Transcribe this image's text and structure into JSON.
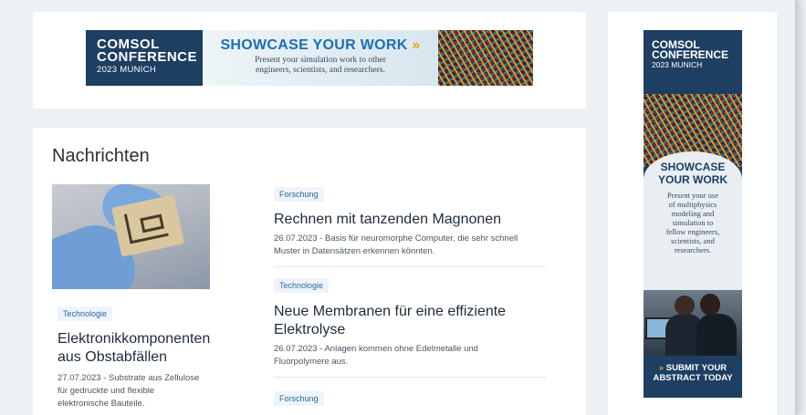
{
  "top_banner": {
    "logo_line1": "COMSOL",
    "logo_line2": "CONFERENCE",
    "logo_line3": "2023 MUNICH",
    "headline": "SHOWCASE YOUR WORK",
    "headline_arrow": "»",
    "sub_line1": "Present your simulation work to other",
    "sub_line2": "engineers, scientists, and researchers."
  },
  "news": {
    "section_title": "Nachrichten",
    "featured": {
      "tag": "Technologie",
      "title_line1": "Elektronikkomponenten",
      "title_line2": "aus Obstabfällen",
      "desc_line1": "27.07.2023 - Substrate aus Zellulose",
      "desc_line2": "für gedruckte und flexible",
      "desc_line3": "elektronische Bauteile."
    },
    "articles": [
      {
        "tag": "Forschung",
        "title_line1": "Rechnen mit tanzenden Magnonen",
        "desc_line1": "26.07.2023 - Basis für neuromorphe Computer, die sehr schnell",
        "desc_line2": "Muster in Datensätzen erkennen könnten."
      },
      {
        "tag": "Technologie",
        "title_line1": "Neue Membranen für eine effiziente",
        "title_line2": "Elektrolyse",
        "desc_line1": "26.07.2023 - Anlagen kommen ohne Edelmetalle und",
        "desc_line2": "Fluorpolymere aus."
      },
      {
        "tag": "Forschung"
      }
    ]
  },
  "side_banner": {
    "logo_line1": "COMSOL",
    "logo_line2": "CONFERENCE",
    "logo_line3": "2023 MUNICH",
    "headline_line1": "SHOWCASE",
    "headline_line2": "YOUR WORK",
    "sub_lines": [
      "Present your use",
      "of multiphysics",
      "modeling and",
      "simulation to",
      "fellow engineers,",
      "scientists, and",
      "researchers."
    ],
    "cta_arrow": "»",
    "cta_line1": "SUBMIT YOUR",
    "cta_line2": "ABSTRACT TODAY"
  },
  "colors": {
    "brand_navy": "#1e3e62",
    "accent_orange": "#f29b22",
    "headline_blue": "#1b6fb5",
    "tag_text": "#2c6a9c"
  }
}
